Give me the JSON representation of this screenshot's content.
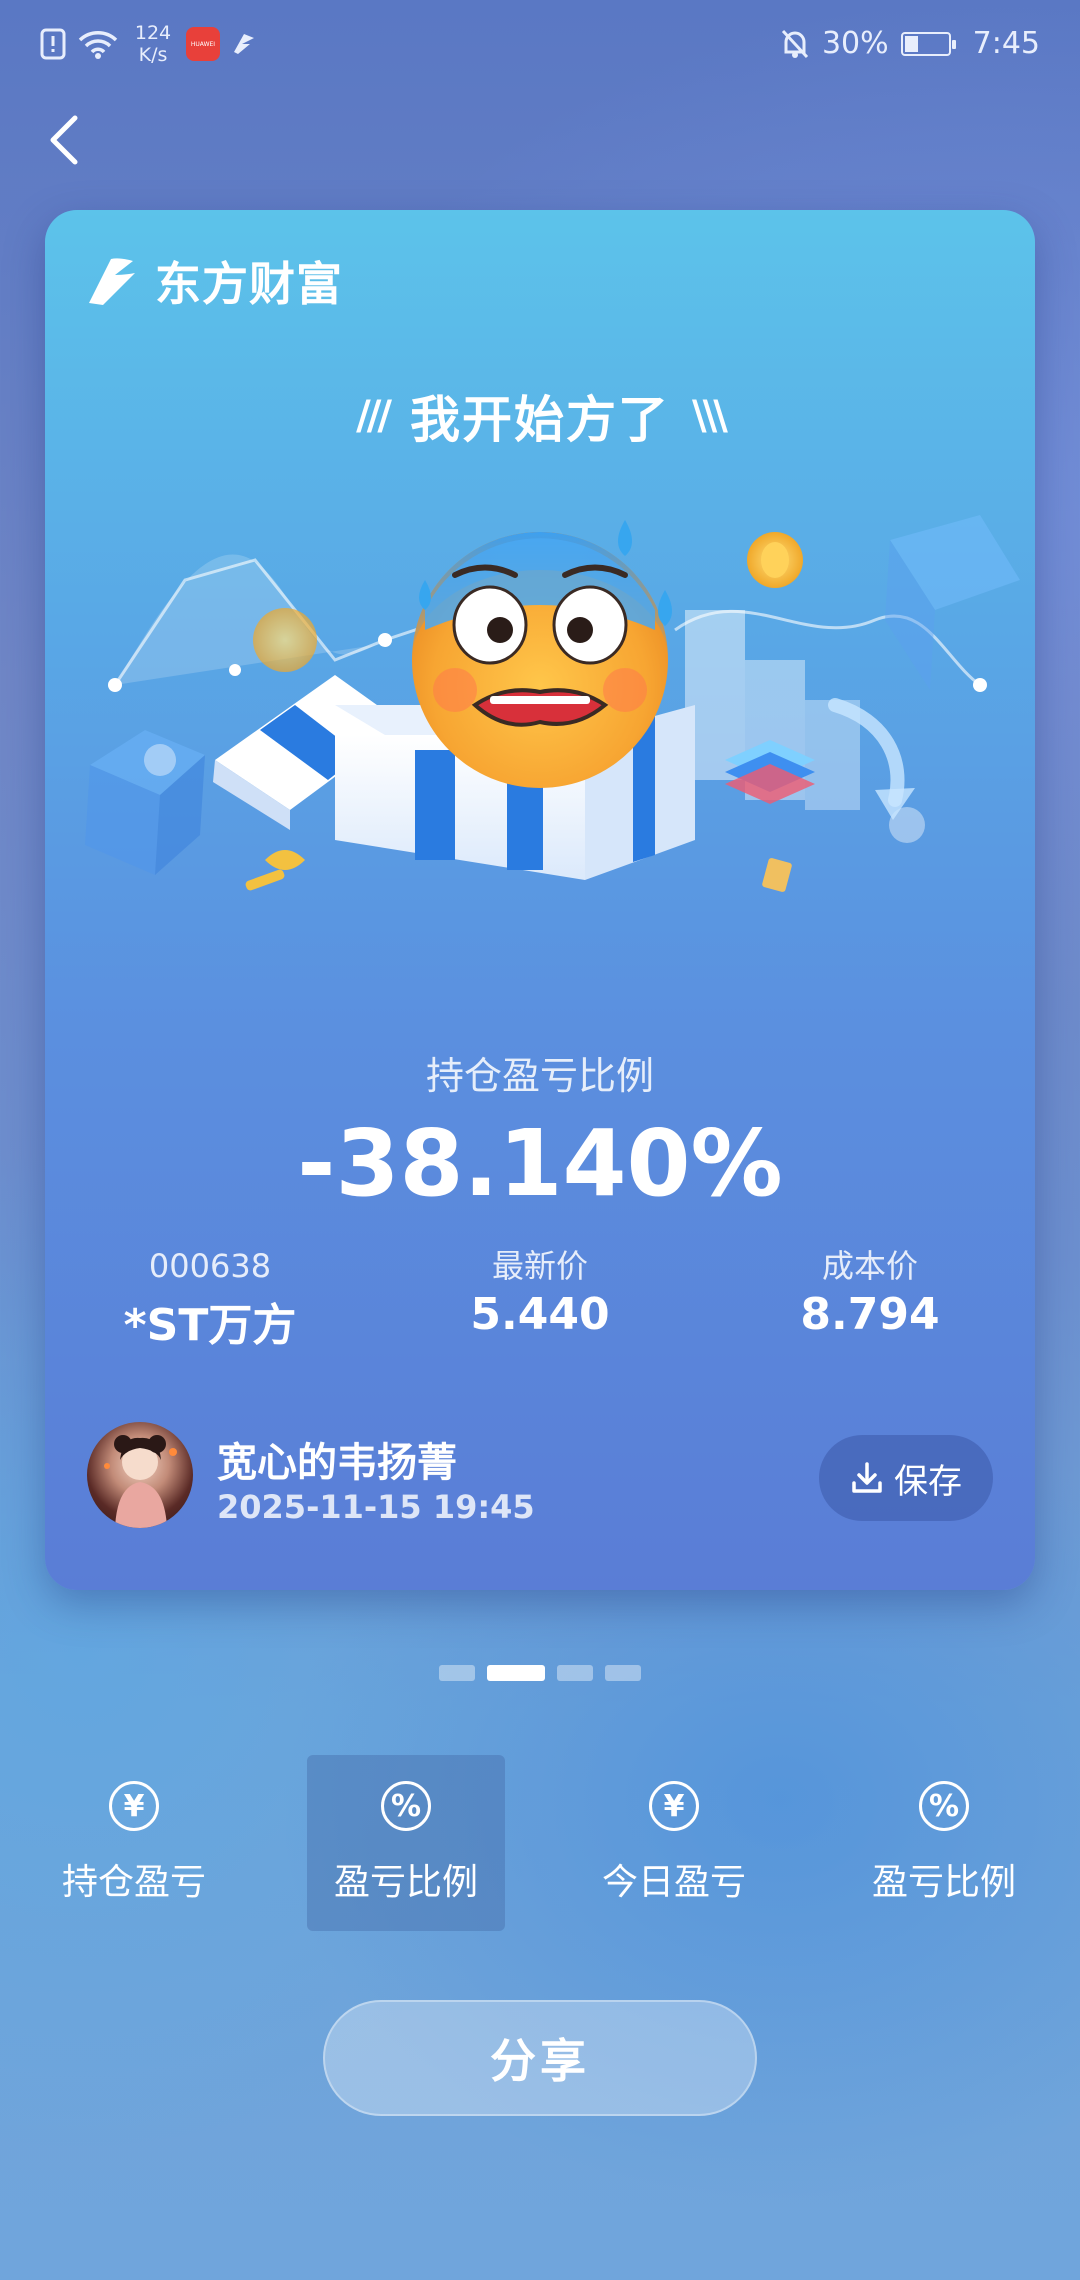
{
  "status_bar": {
    "net_speed_value": "124",
    "net_speed_unit": "K/s",
    "app_badge": "HUAWEI",
    "battery": "30%",
    "time": "7:45"
  },
  "card": {
    "brand": "东方财富",
    "headline": "我开始方了",
    "ratio_label": "持仓盈亏比例",
    "ratio_value": "-38.140%",
    "stock_code": "000638",
    "stock_name": "*ST万方",
    "latest_price_label": "最新价",
    "latest_price": "5.440",
    "cost_price_label": "成本价",
    "cost_price": "8.794",
    "user_name": "宽心的韦扬菁",
    "post_time": "2025-11-15 19:45",
    "save_label": "保存"
  },
  "pager": {
    "count": 4,
    "active_index": 1
  },
  "tabs": [
    {
      "label": "持仓盈亏",
      "icon": "yen-icon",
      "glyph": "¥"
    },
    {
      "label": "盈亏比例",
      "icon": "percent-icon",
      "glyph": "%",
      "active": true
    },
    {
      "label": "今日盈亏",
      "icon": "yen-icon",
      "glyph": "¥"
    },
    {
      "label": "盈亏比例",
      "icon": "percent-icon",
      "glyph": "%"
    }
  ],
  "share_label": "分享",
  "colors": {
    "card_top": "#5cc3ea",
    "card_bottom": "#5a7dd6",
    "emoji_face": "#f7a93a",
    "box_stripe": "#2a7be0"
  }
}
